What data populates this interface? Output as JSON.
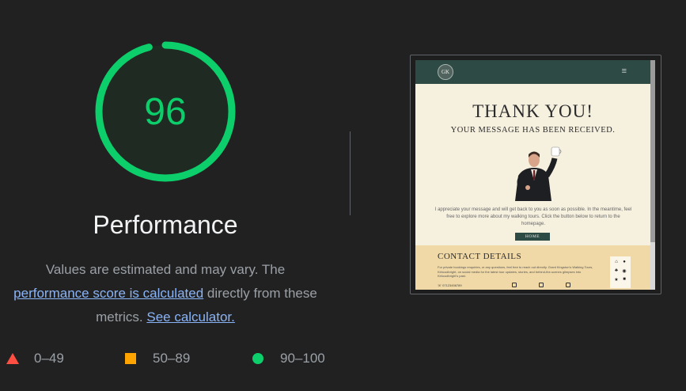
{
  "gauge": {
    "score": "96",
    "score_value": 96,
    "title": "Performance",
    "color": "#0cce6b"
  },
  "description": {
    "prefix": "Values are estimated and may vary. The",
    "link1": "performance score is calculated",
    "middle": "directly from these metrics.",
    "link2": "See calculator."
  },
  "legend": [
    {
      "shape": "triangle",
      "range": "0–49",
      "color": "#ff4e42"
    },
    {
      "shape": "square",
      "range": "50–89",
      "color": "#ffa400"
    },
    {
      "shape": "circle",
      "range": "90–100",
      "color": "#0cce6b"
    }
  ],
  "screenshot": {
    "logo": "GK",
    "menu_icon": "≡",
    "heading": "THANK YOU!",
    "subheading": "YOUR MESSAGE HAS BEEN RECEIVED.",
    "message": "I appreciate your message and will get back to you as soon as possible. In the meantime, feel free to explore more about my walking tours. Click the button below to return to the homepage.",
    "button": "HOME",
    "contact_title": "CONTACT DETAILS",
    "contact_text": "For private bookings enquiries, or any questions, feel free to reach out directly. Grant Kingston's Walking Tours, Kirkcudbright, on social media for the latest tour updates, stories, and behind-the-scenes glimpses into Kirkcudbright's past.",
    "phone": "07123456789"
  }
}
